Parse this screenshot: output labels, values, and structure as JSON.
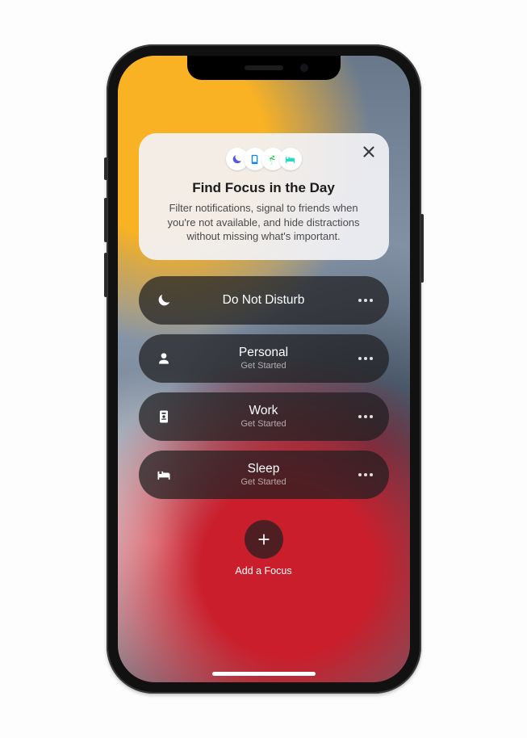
{
  "header": {
    "title": "Find Focus in the Day",
    "description": "Filter notifications, signal to friends when you're not available, and hide distractions without missing what's important.",
    "icons": [
      "moon-icon",
      "book-icon",
      "running-icon",
      "bed-icon"
    ],
    "icon_colors": [
      "#5856d6",
      "#0a84ff",
      "#30d158",
      "#2fd8c4"
    ]
  },
  "focus_modes": [
    {
      "icon": "moon-icon",
      "title": "Do Not Disturb",
      "subtitle": ""
    },
    {
      "icon": "person-icon",
      "title": "Personal",
      "subtitle": "Get Started"
    },
    {
      "icon": "badge-icon",
      "title": "Work",
      "subtitle": "Get Started"
    },
    {
      "icon": "bed-icon",
      "title": "Sleep",
      "subtitle": "Get Started"
    }
  ],
  "add_focus_label": "Add a Focus"
}
